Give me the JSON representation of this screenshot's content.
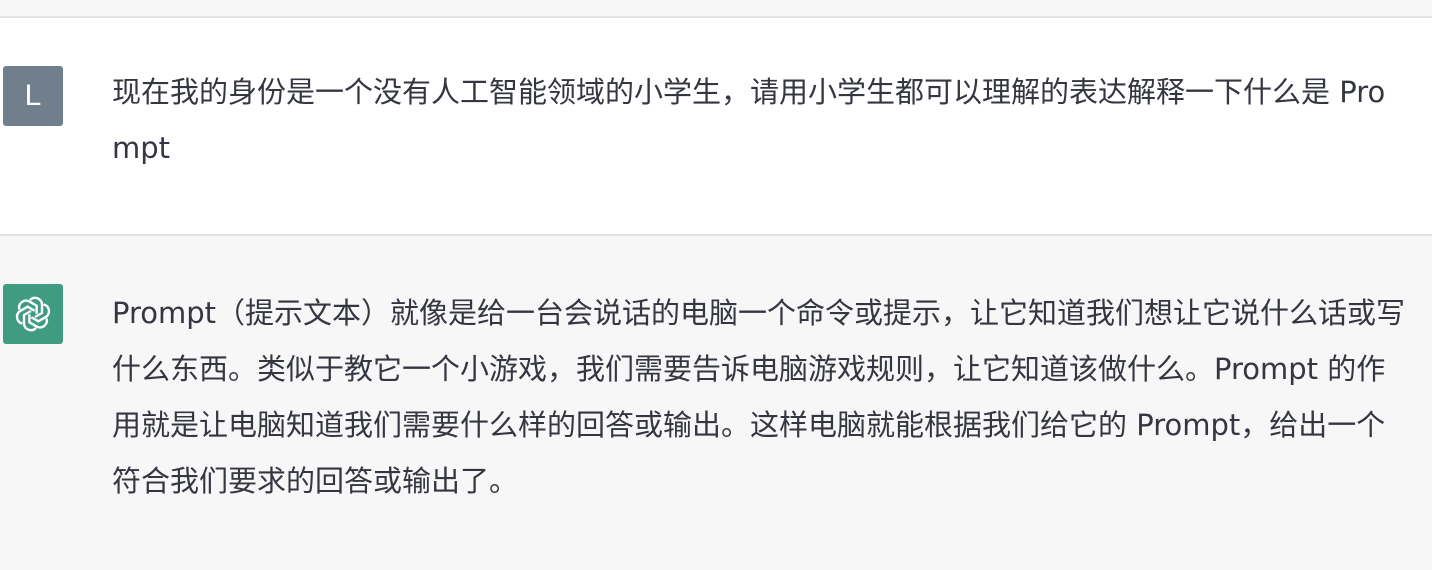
{
  "conversation": {
    "user_message": {
      "avatar_letter": "L",
      "text": "现在我的身份是一个没有人工智能领域的小学生，请用小学生都可以理解的表达解释一下什么是 Prompt"
    },
    "assistant_message": {
      "avatar_icon": "openai-logo-icon",
      "text": "Prompt（提示文本）就像是给一台会说话的电脑一个命令或提示，让它知道我们想让它说什么话或写什么东西。类似于教它一个小游戏，我们需要告诉电脑游戏规则，让它知道该做什么。Prompt 的作用就是让电脑知道我们需要什么样的回答或输出。这样电脑就能根据我们给它的 Prompt，给出一个符合我们要求的回答或输出了。"
    }
  },
  "colors": {
    "user_avatar_bg": "#717e8c",
    "bot_avatar_bg": "#3f9c80",
    "user_row_bg": "#ffffff",
    "assistant_row_bg": "#f7f7f8",
    "divider": "#e3e3e6",
    "text": "#353740"
  }
}
